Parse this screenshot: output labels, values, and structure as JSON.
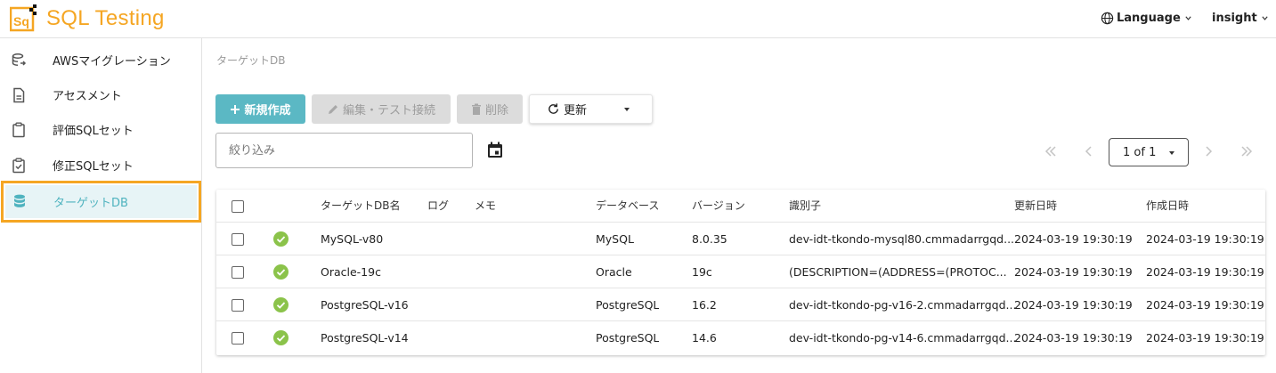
{
  "header": {
    "app_title": "SQL Testing",
    "logo_text": "Sq",
    "language_label": "Language",
    "user_label": "insight",
    "brand_color": "#f5a623"
  },
  "sidebar": {
    "items": [
      {
        "label": "AWSマイグレーション",
        "icon": "database-migrate-icon"
      },
      {
        "label": "アセスメント",
        "icon": "document-icon"
      },
      {
        "label": "評価SQLセット",
        "icon": "clipboard-icon"
      },
      {
        "label": "修正SQLセット",
        "icon": "clipboard-check-icon"
      },
      {
        "label": "ターゲットDB",
        "icon": "database-icon",
        "active": true
      }
    ]
  },
  "main": {
    "breadcrumb": "ターゲットDB",
    "toolbar": {
      "new_label": "新規作成",
      "edit_label": "編集・テスト接続",
      "delete_label": "削除",
      "refresh_label": "更新"
    },
    "filter": {
      "placeholder": "絞り込み"
    },
    "pagination": {
      "label": "1 of 1"
    },
    "accent_color": "#5bb8c4"
  },
  "table": {
    "columns": [
      "ターゲットDB名",
      "ログ",
      "メモ",
      "データベース",
      "バージョン",
      "識別子",
      "更新日時",
      "作成日時"
    ],
    "rows": [
      {
        "name": "MySQL-v80",
        "db": "MySQL",
        "version": "8.0.35",
        "identifier": "dev-idt-tkondo-mysql80.cmmadarrgqd...",
        "updated": "2024-03-19 19:30:19",
        "created": "2024-03-19 19:30:19",
        "status": "ok"
      },
      {
        "name": "Oracle-19c",
        "db": "Oracle",
        "version": "19c",
        "identifier": "(DESCRIPTION=(ADDRESS=(PROTOC...",
        "updated": "2024-03-19 19:30:19",
        "created": "2024-03-19 19:30:19",
        "status": "ok"
      },
      {
        "name": "PostgreSQL-v16",
        "db": "PostgreSQL",
        "version": "16.2",
        "identifier": "dev-idt-tkondo-pg-v16-2.cmmadarrgqd...",
        "updated": "2024-03-19 19:30:19",
        "created": "2024-03-19 19:30:19",
        "status": "ok"
      },
      {
        "name": "PostgreSQL-v14",
        "db": "PostgreSQL",
        "version": "14.6",
        "identifier": "dev-idt-tkondo-pg-v14-6.cmmadarrgqd...",
        "updated": "2024-03-19 19:30:19",
        "created": "2024-03-19 19:30:19",
        "status": "ok"
      }
    ],
    "status_color": "#8bc34a"
  }
}
